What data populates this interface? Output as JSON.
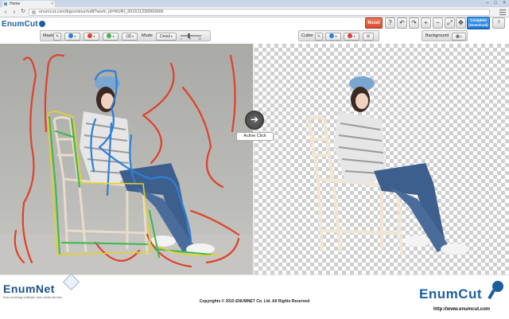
{
  "browser": {
    "tab_title": "Home",
    "tab_close": "×",
    "url": "enumcut.com/bgcontour/edit?work_id=NURI_201511230000666",
    "back": "‹",
    "forward": "›",
    "reload": "↻",
    "win_min": "–",
    "win_max": "□",
    "win_close": "×"
  },
  "app": {
    "logo_text": "EnumCut",
    "mask_toolbar": {
      "label": "Mask",
      "mode_label": "Mode",
      "mode_value": "Detail",
      "slider_ticks": [
        "1",
        "5",
        "10"
      ],
      "slider_level": 0.4
    },
    "cutter_toolbar": {
      "label": "Cutter",
      "background_label": "Background"
    },
    "top_actions": {
      "reset_label": "Reset",
      "help_symbol": "?",
      "undo_symbol": "↶",
      "redo_symbol": "↷",
      "zoom_in_symbol": "+",
      "zoom_out_symbol": "−",
      "fit_symbol": "⤢",
      "move_symbol": "✥",
      "complete_label": "Complete",
      "complete_sub": "(Download)",
      "help2_symbol": "?"
    },
    "active_click": {
      "arrow": "➔",
      "label": "Active Click"
    }
  },
  "footer": {
    "enumnet_logo": "EnumNet",
    "enumnet_tagline": "Ever-evolving  software and useful service.",
    "copyright": "Copyrights © 2015 ENUMNET Co. Ltd. All Rights Reserved",
    "enumcut_logo": "EnumCut",
    "site_url": "http://www.enumcut.com"
  },
  "colors": {
    "brand_blue": "#1b5e9e",
    "reset_red": "#d94a2c",
    "complete_blue": "#1a74d0",
    "stroke_red": "#e0402a",
    "stroke_blue": "#2d7fd6",
    "stroke_green": "#3cb84a",
    "stroke_yellow": "#e3d22a"
  }
}
